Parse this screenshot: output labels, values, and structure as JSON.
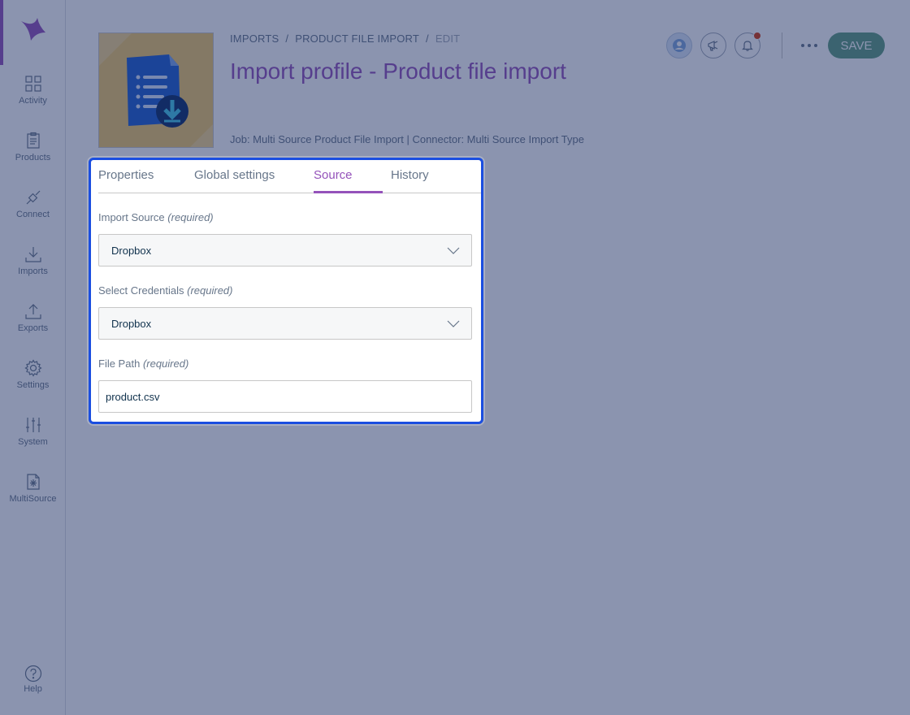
{
  "sidebar": {
    "items": [
      {
        "label": "Activity",
        "icon": "dashboard-icon"
      },
      {
        "label": "Products",
        "icon": "clipboard-icon"
      },
      {
        "label": "Connect",
        "icon": "plug-icon"
      },
      {
        "label": "Imports",
        "icon": "download-icon"
      },
      {
        "label": "Exports",
        "icon": "upload-icon"
      },
      {
        "label": "Settings",
        "icon": "gear-icon"
      },
      {
        "label": "System",
        "icon": "sliders-icon"
      },
      {
        "label": "MultiSource",
        "icon": "multisource-icon"
      }
    ],
    "help_label": "Help"
  },
  "breadcrumb": {
    "level1": "IMPORTS",
    "level2": "PRODUCT FILE IMPORT",
    "current": "EDIT",
    "separator": "/"
  },
  "header": {
    "title": "Import profile - Product file import",
    "meta": "Job: Multi Source Product File Import | Connector: Multi Source Import Type",
    "save_label": "SAVE",
    "more_label": "•••"
  },
  "tabs": [
    {
      "label": "Properties",
      "active": false
    },
    {
      "label": "Global settings",
      "active": false
    },
    {
      "label": "Source",
      "active": true
    },
    {
      "label": "History",
      "active": false
    }
  ],
  "form": {
    "import_source": {
      "label": "Import Source",
      "hint": "(required)",
      "value": "Dropbox"
    },
    "credentials": {
      "label": "Select Credentials",
      "hint": "(required)",
      "value": "Dropbox"
    },
    "file_path": {
      "label": "File Path",
      "hint": "(required)",
      "value": "product.csv"
    }
  },
  "colors": {
    "brand": "#9452ba",
    "save": "#5e9c80",
    "focus": "#1a4ee0",
    "overlay": "rgba(23,42,96,0.5)"
  }
}
